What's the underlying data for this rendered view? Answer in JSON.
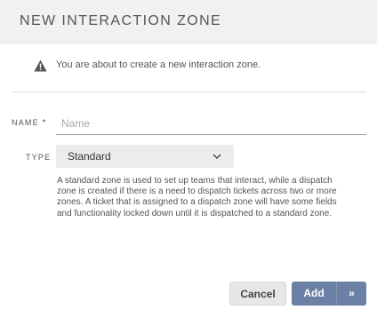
{
  "dialog": {
    "title": "NEW INTERACTION ZONE",
    "notice": "You are about to create a new interaction zone."
  },
  "form": {
    "name": {
      "label": "NAME",
      "required_marker": "*",
      "value": "",
      "placeholder": "Name"
    },
    "type": {
      "label": "TYPE",
      "selected": "Standard",
      "help": "A standard zone is used to set up teams that interact, while a dispatch zone is created if there is a need to dispatch tickets across two or more zones. A ticket that is assigned to a dispatch zone will have some fields and functionality locked down until it is dispatched to a standard zone."
    }
  },
  "actions": {
    "cancel_label": "Cancel",
    "add_label": "Add",
    "add_more_glyph": "»"
  },
  "icons": {
    "notice": "warning-icon",
    "select": "chevron-down-icon"
  },
  "colors": {
    "header_bg": "#f1f1f1",
    "primary": "#6a80a5",
    "select_bg": "#ececec"
  }
}
